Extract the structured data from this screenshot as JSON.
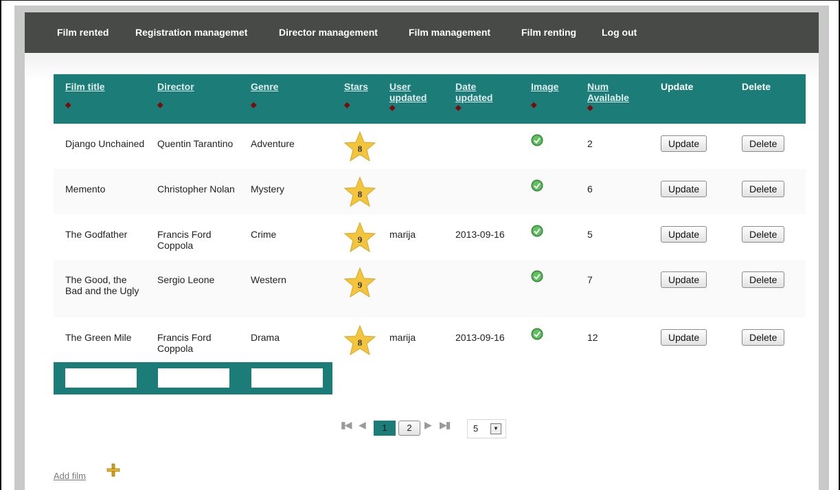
{
  "nav": {
    "items": [
      {
        "label": "Film rented"
      },
      {
        "label": "Registration managemet"
      },
      {
        "label": "Director management"
      },
      {
        "label": "Film management"
      },
      {
        "label": "Film renting"
      },
      {
        "label": "Log out"
      }
    ]
  },
  "table": {
    "headers": {
      "film_title": "Film title",
      "director": "Director",
      "genre": "Genre",
      "stars": "Stars",
      "user_updated": "User updated",
      "date_updated": "Date updated",
      "image": "Image",
      "num_available": "Num Available",
      "update": "Update",
      "delete": "Delete"
    },
    "sort_icon": "sort-arrows-icon",
    "rows": [
      {
        "title": "Django Unchained",
        "director": "Quentin Tarantino",
        "genre": "Adventure",
        "stars": "8",
        "user": "",
        "date": "",
        "image": "check-icon",
        "num": "2"
      },
      {
        "title": "Memento",
        "director": "Christopher Nolan",
        "genre": "Mystery",
        "stars": "8",
        "user": "",
        "date": "",
        "image": "check-icon",
        "num": "6"
      },
      {
        "title": "The Godfather",
        "director": "Francis Ford Coppola",
        "genre": "Crime",
        "stars": "9",
        "user": "marija",
        "date": "2013-09-16",
        "image": "check-icon",
        "num": "5"
      },
      {
        "title": "The Good, the Bad and the Ugly",
        "director": "Sergio Leone",
        "genre": "Western",
        "stars": "9",
        "user": "",
        "date": "",
        "image": "check-icon",
        "num": "7"
      },
      {
        "title": "The Green Mile",
        "director": "Francis Ford Coppola",
        "genre": "Drama",
        "stars": "8",
        "user": "marija",
        "date": "2013-09-16",
        "image": "check-icon",
        "num": "12"
      }
    ],
    "update_button": "Update",
    "delete_button": "Delete",
    "filters": {
      "title": "",
      "director": "",
      "genre": ""
    }
  },
  "pager": {
    "pages": [
      "1",
      "2"
    ],
    "current_page": "1",
    "per_page": "5"
  },
  "add_film": "Add film",
  "colors": {
    "nav_bg": "#484a48",
    "table_header": "#1c7d78",
    "star": "#f2c53c"
  }
}
